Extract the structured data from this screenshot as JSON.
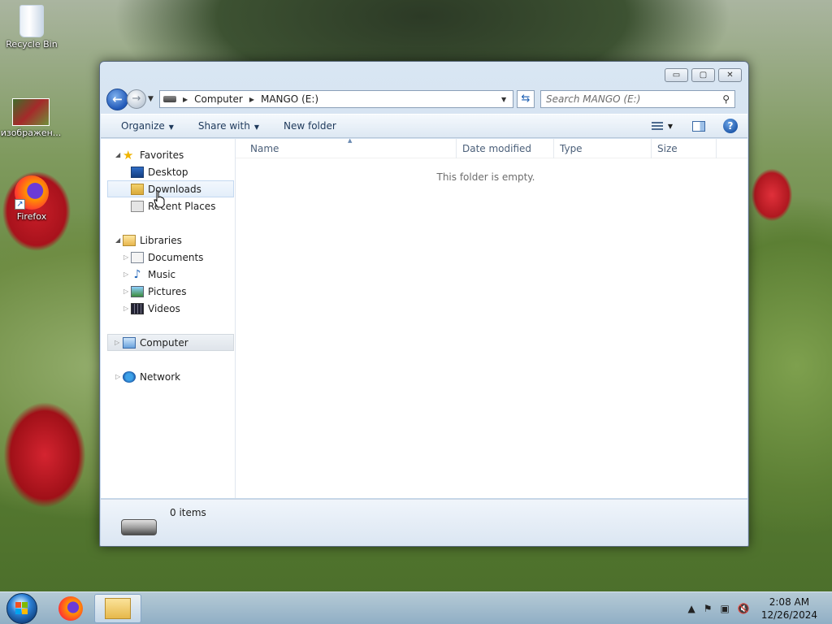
{
  "desktop": {
    "icons": [
      {
        "label": "Recycle Bin"
      },
      {
        "label": "изображен..."
      },
      {
        "label": "Firefox"
      }
    ]
  },
  "window": {
    "controls": {
      "minimize": "▭",
      "maximize": "▢",
      "close": "✕"
    },
    "address": {
      "crumbs": [
        "Computer",
        "MANGO (E:)"
      ]
    },
    "search": {
      "placeholder": "Search MANGO (E:)"
    },
    "toolbar": {
      "organize": "Organize",
      "share_with": "Share with",
      "new_folder": "New folder"
    },
    "nav": {
      "favorites": "Favorites",
      "desktop": "Desktop",
      "downloads": "Downloads",
      "recent_places": "Recent Places",
      "libraries": "Libraries",
      "documents": "Documents",
      "music": "Music",
      "pictures": "Pictures",
      "videos": "Videos",
      "computer": "Computer",
      "network": "Network"
    },
    "columns": [
      "Name",
      "Date modified",
      "Type",
      "Size"
    ],
    "empty_message": "This folder is empty.",
    "details": {
      "item_count": "0 items"
    }
  },
  "taskbar": {
    "clock": {
      "time": "2:08 AM",
      "date": "12/26/2024"
    }
  },
  "colors": {
    "accent": "#2159b8",
    "window_frame": "#c4d6ea",
    "taskbar": "#a8c0da"
  }
}
